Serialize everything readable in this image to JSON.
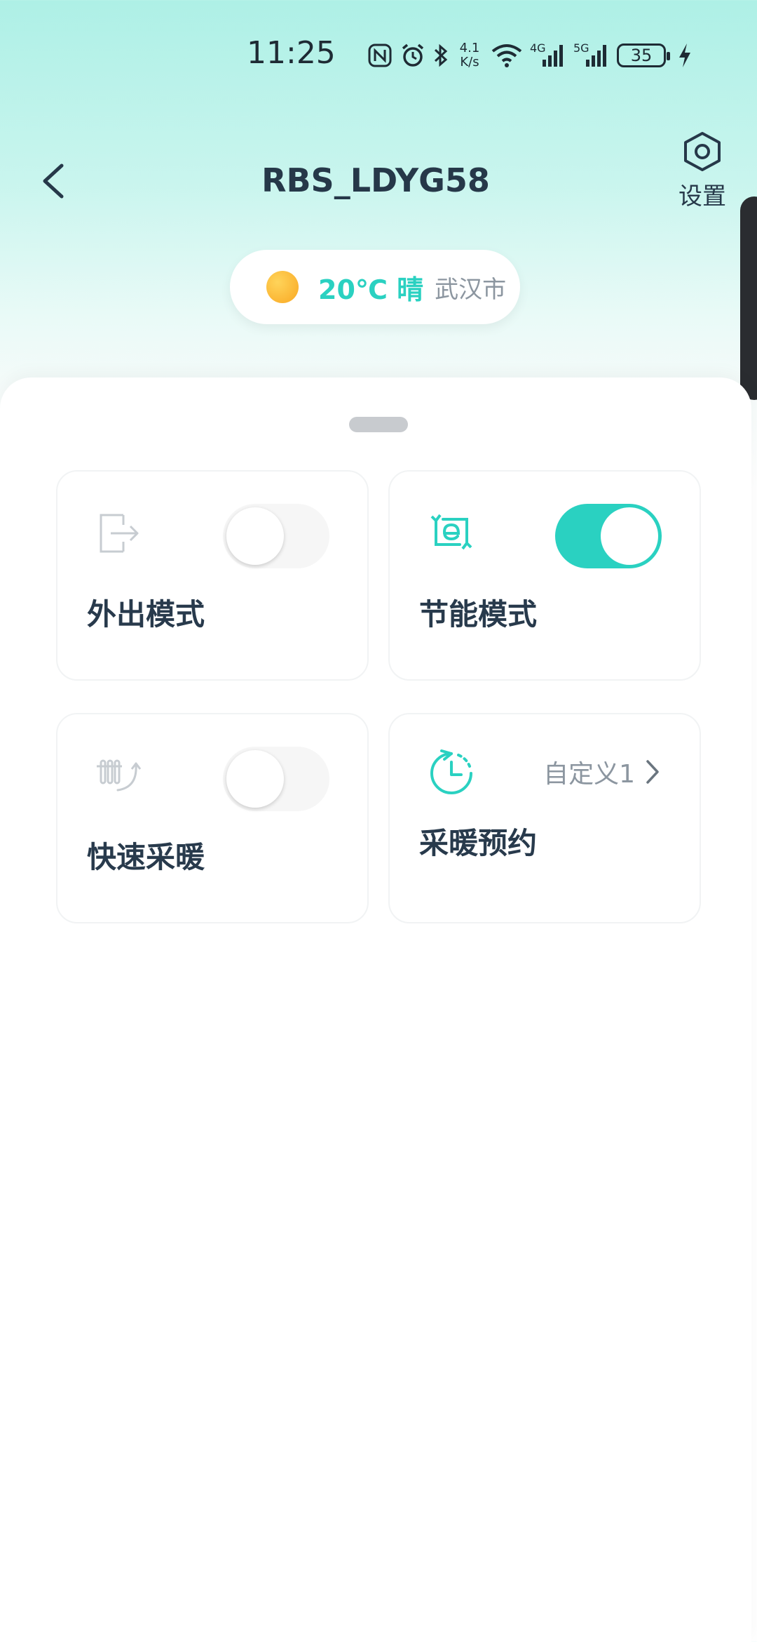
{
  "status_bar": {
    "time": "11:25",
    "speed_value": "4.1",
    "speed_unit": "K/s",
    "battery": "35",
    "net1": "4G",
    "net2": "5G"
  },
  "header": {
    "title": "RBS_LDYG58",
    "settings_label": "设置"
  },
  "weather": {
    "temp": "20℃ 晴",
    "city": "武汉市"
  },
  "cards": {
    "away": {
      "label": "外出模式",
      "enabled": false
    },
    "eco": {
      "label": "节能模式",
      "enabled": true
    },
    "quick_heat": {
      "label": "快速采暖",
      "enabled": false
    },
    "schedule": {
      "label": "采暖预约",
      "value": "自定义1"
    }
  },
  "colors": {
    "accent": "#2ad1c1",
    "text": "#283a4c",
    "muted": "#8c96a0"
  }
}
